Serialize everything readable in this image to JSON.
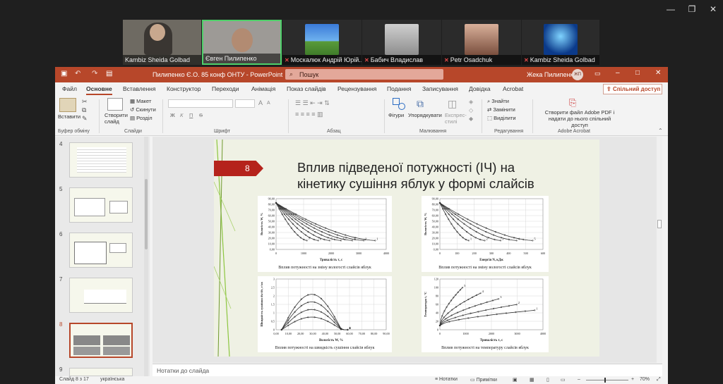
{
  "meeting": {
    "window_controls": [
      "—",
      "❐",
      "✕"
    ],
    "participants": [
      {
        "name": "Kambiz Sheida Golbad",
        "muted": false
      },
      {
        "name": "Євген Пилипенко",
        "muted": false
      },
      {
        "name": "Москалюк Андрій Юрій...",
        "muted": true
      },
      {
        "name": "Бабич Владислав",
        "muted": true
      },
      {
        "name": "Petr Osadchuk",
        "muted": true
      },
      {
        "name": "Kambiz Sheida Golbad",
        "muted": true
      }
    ]
  },
  "ppt": {
    "title": "Пилипенко Є.О. 85 конф ОНТУ  -  PowerPoint",
    "search_placeholder": "Пошук",
    "user_name": "Жека Пилипенко",
    "user_initials": "ЖП",
    "tabs": [
      "Файл",
      "Основне",
      "Вставлення",
      "Конструктор",
      "Переходи",
      "Анімація",
      "Показ слайдів",
      "Рецензування",
      "Подання",
      "Записування",
      "Довідка",
      "Acrobat"
    ],
    "share_label": "Спільний доступ",
    "ribbon": {
      "paste": "Вставити",
      "clipboard_group": "Буфер обміну",
      "new_slide": "Створити слайд",
      "layout": "Макет",
      "reset": "Скинути",
      "section": "Розділ",
      "slides_group": "Слайди",
      "font_group": "Шрифт",
      "paragraph_group": "Абзац",
      "shapes": "Фігури",
      "arrange": "Упорядкувати",
      "quick_styles": "Експрес-стилі",
      "drawing_group": "Малювання",
      "find": "Знайти",
      "replace": "Замінити",
      "select": "Виділити",
      "editing_group": "Редагування",
      "acrobat_btn": "Створити файл Adobe PDF і надати до нього спільний доступ",
      "acrobat_group": "Adobe Acrobat",
      "font_bold": "Ж",
      "font_italic": "К",
      "font_underline": "П",
      "font_strike": "S",
      "font_grow": "A",
      "font_shrink": "A"
    },
    "thumbnail_numbers": [
      "4",
      "5",
      "6",
      "7",
      "8",
      "9"
    ],
    "selected_thumbnail": "8",
    "notes_placeholder": "Нотатки до слайда",
    "status": {
      "slide_counter": "Слайд 8 з 17",
      "language": "українська",
      "notes_btn": "Нотатки",
      "comments_btn": "Примітки",
      "zoom": "70%"
    },
    "slide": {
      "number": "8",
      "title_line1": "Вплив підведеної потужності (ІЧ) на",
      "title_line2": "кінетику сушіння яблук у формі слайсів",
      "chart1": {
        "ylabel": "Вологість W, %",
        "xlabel": "Тривалість τ, с",
        "yticks": [
          "90,00",
          "80,00",
          "70,00",
          "60,00",
          "50,00",
          "40,00",
          "30,00",
          "20,00",
          "10,00",
          "0,00"
        ],
        "xticks": [
          "0",
          "1000",
          "2000",
          "3000",
          "4000"
        ],
        "curve_labels": [
          "7",
          "6",
          "5",
          "4",
          "3",
          "2",
          "1"
        ],
        "caption": "Вплив потужності на зміну вологості слайсів яблук"
      },
      "chart2": {
        "ylabel": "Вологість W, %",
        "xlabel": "Енергія N, кДж",
        "yticks": [
          "90,00",
          "80,00",
          "70,00",
          "60,00",
          "50,00",
          "40,00",
          "30,00",
          "20,00",
          "10,00",
          "0,00"
        ],
        "xticks": [
          "0",
          "100",
          "200",
          "300",
          "400",
          "500",
          "600"
        ],
        "curve_labels": [
          "1",
          "2",
          "3",
          "4",
          "5"
        ],
        "caption": "Вплив потужності на зміну вологості слайсів яблук"
      },
      "chart3": {
        "ylabel": "Швидкість сушіння dw/dτ, г/хв",
        "xlabel": "Вологість W, %",
        "yticks": [
          "3",
          "2,5",
          "2",
          "1,5",
          "1",
          "0,5",
          "0"
        ],
        "xticks": [
          "0,00",
          "10,00",
          "20,00",
          "30,00",
          "40,00",
          "50,00",
          "60,00",
          "70,00",
          "80,00",
          "90,00"
        ],
        "curve_labels": [
          "4",
          "3",
          "2",
          "1"
        ],
        "caption": "Вплив потужності на швидкість сушіння слайсів яблук"
      },
      "chart4": {
        "ylabel": "Температура t, °С",
        "xlabel": "Тривалість τ, с",
        "yticks": [
          "120",
          "100",
          "80",
          "60",
          "40",
          "20",
          "0"
        ],
        "xticks": [
          "0",
          "1000",
          "2000",
          "3000",
          "4000"
        ],
        "curve_labels": [
          "5",
          "4",
          "3",
          "2",
          "1"
        ],
        "caption": "Вплив потужності на температуру слайсів яблук"
      }
    }
  },
  "colors": {
    "ppt_red": "#b7472a",
    "slide_bg": "#eff1e4",
    "slide_number_bg": "#b5231c",
    "accent_green": "#8cc63f"
  }
}
